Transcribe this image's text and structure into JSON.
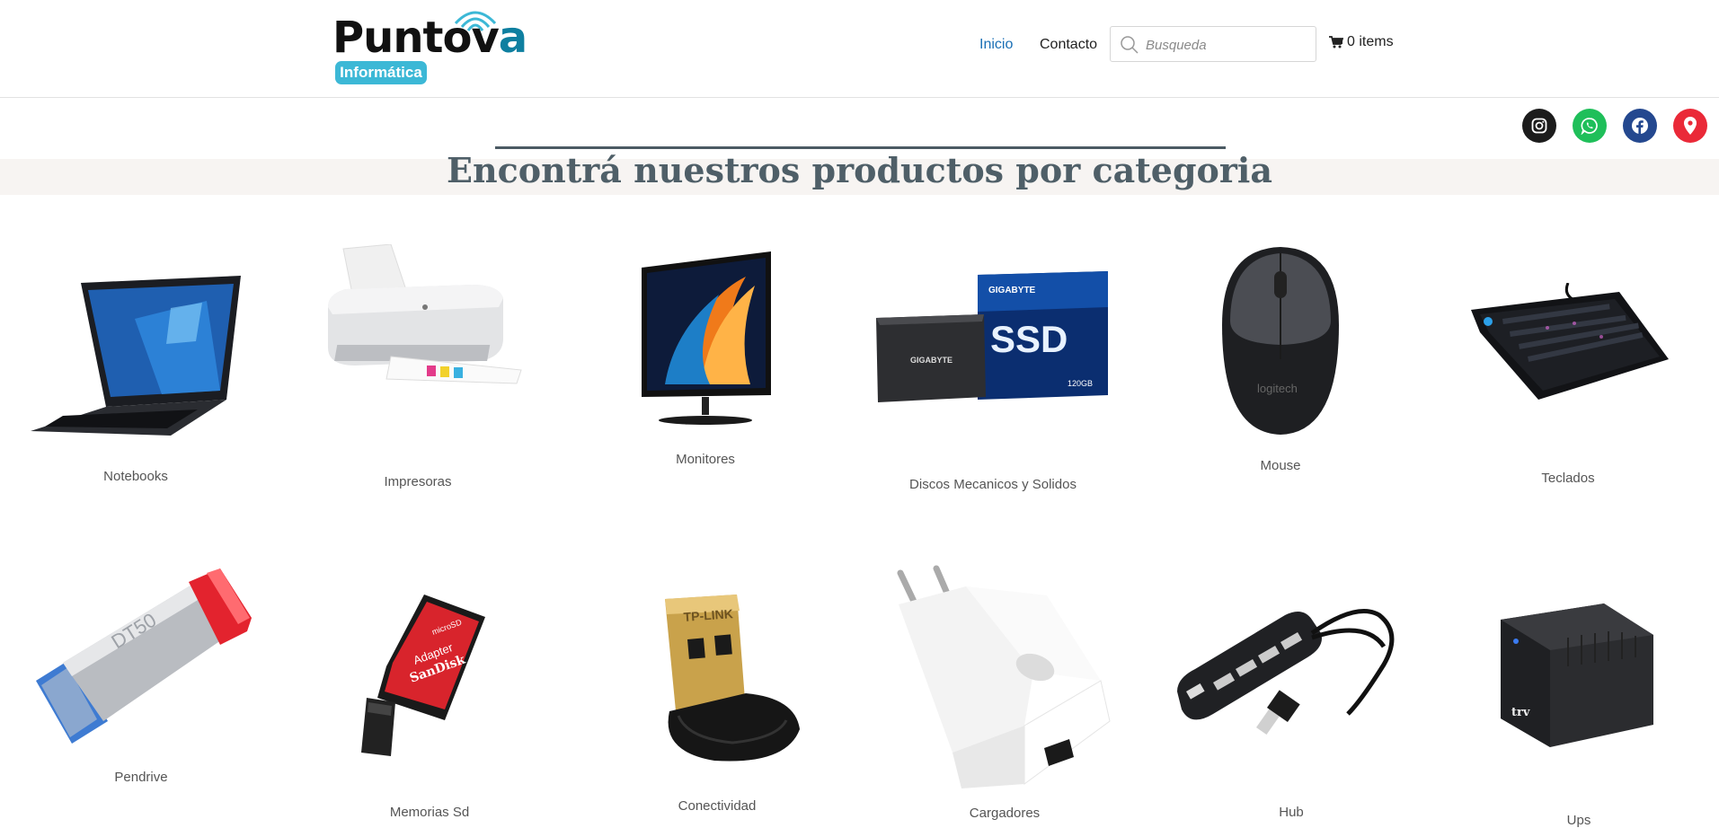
{
  "header": {
    "logo_word": "Puntov",
    "logo_word_end": "a",
    "logo_badge": "Informática",
    "nav": [
      {
        "label": "Inicio",
        "active": true
      },
      {
        "label": "Contacto",
        "active": false
      }
    ],
    "search_placeholder": "Busqueda",
    "cart_label": "0 items"
  },
  "social": [
    {
      "icon": "instagram-icon",
      "color": "#1c1c1c"
    },
    {
      "icon": "whatsapp-icon",
      "color": "#1fbf5a"
    },
    {
      "icon": "facebook-icon",
      "color": "#24488f"
    },
    {
      "icon": "map-pin-icon",
      "color": "#ea2938"
    }
  ],
  "section_title": "Encontrá nuestros productos por categoria",
  "categories": [
    {
      "label": "Notebooks",
      "image": "laptop"
    },
    {
      "label": "Impresoras",
      "image": "printer"
    },
    {
      "label": "Monitores",
      "image": "monitor"
    },
    {
      "label": "Discos Mecanicos y Solidos",
      "image": "ssd"
    },
    {
      "label": "Mouse",
      "image": "mouse"
    },
    {
      "label": "Teclados",
      "image": "keyboard"
    },
    {
      "label": "Pendrive",
      "image": "usb-drive"
    },
    {
      "label": "Memorias Sd",
      "image": "sd-card"
    },
    {
      "label": "Conectividad",
      "image": "wifi-adapter"
    },
    {
      "label": "Cargadores",
      "image": "charger"
    },
    {
      "label": "Hub",
      "image": "usb-hub"
    },
    {
      "label": "Ups",
      "image": "ups"
    }
  ],
  "product_brands": {
    "ssd_brand": "GIGABYTE",
    "ssd_text": "SSD",
    "ssd_capacity": "120GB",
    "mouse_brand": "logitech",
    "usb_brand": "DT50",
    "sd_brand": "SanDisk",
    "sd_adapter": "Adapter",
    "sd_type": "microSD",
    "wifi_brand": "TP-LINK",
    "ups_brand": "trv"
  },
  "colors": {
    "accent": "#1a6fb5",
    "title": "#4f5f68",
    "logo_blue": "#3cb8d6"
  }
}
